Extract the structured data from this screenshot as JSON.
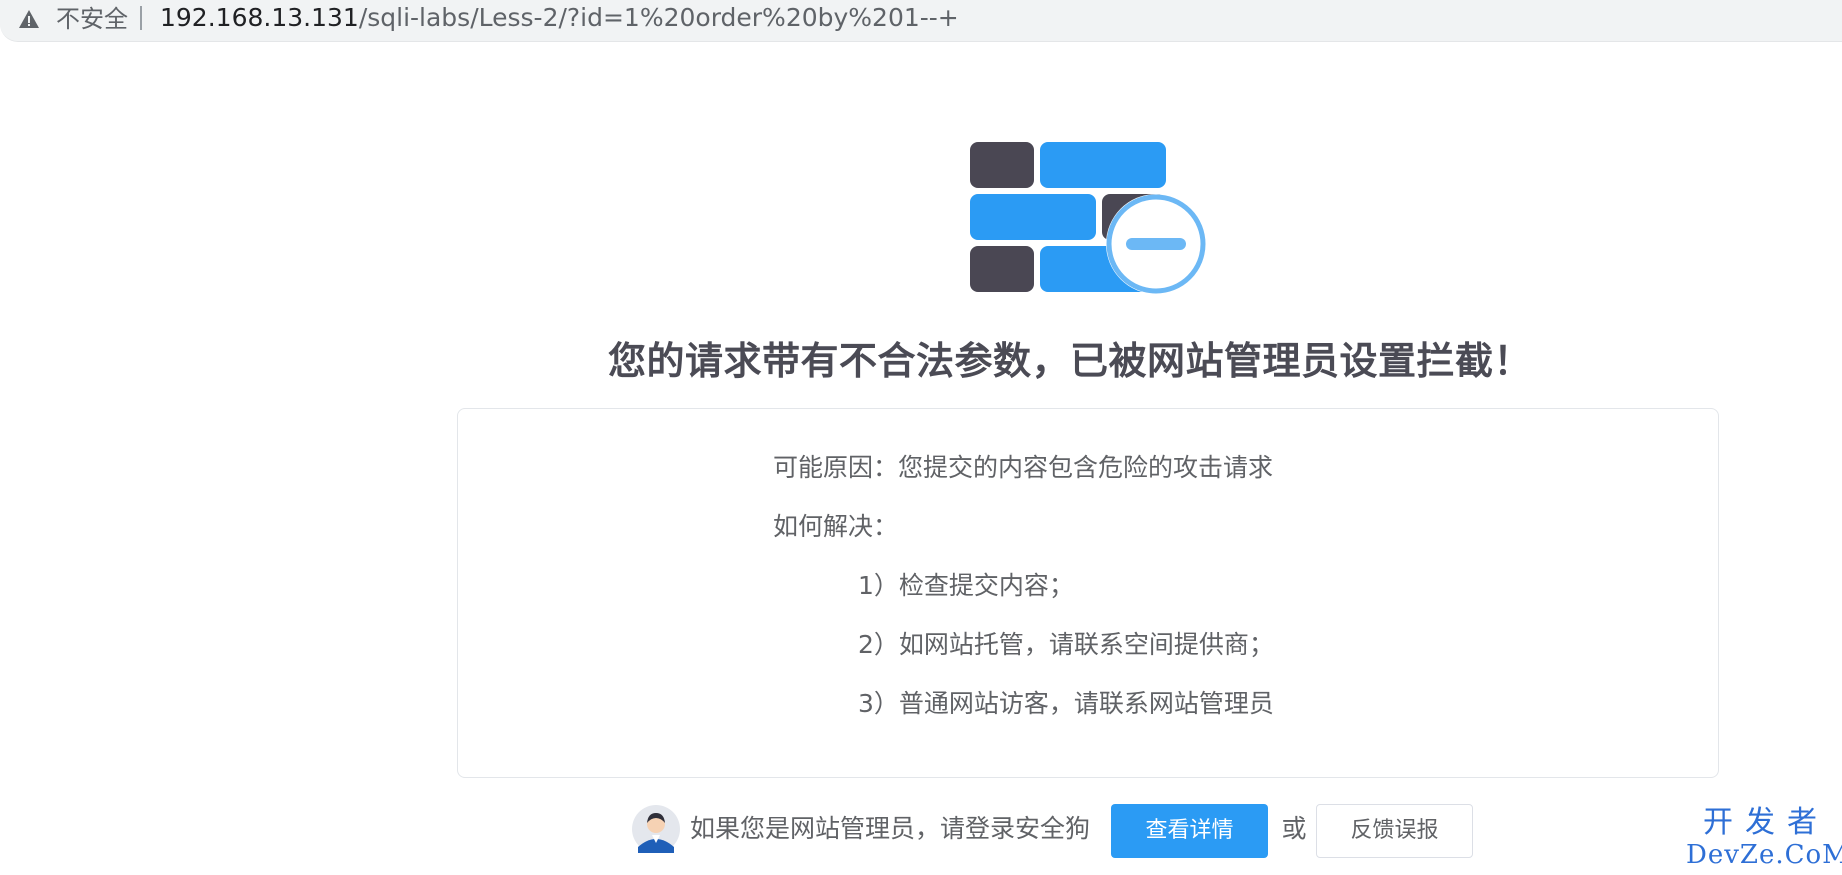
{
  "browser": {
    "security_label": "不安全",
    "url_host": "192.168.13.131",
    "url_path": "/sqli-labs/Less-2/?id=1%20order%20by%201--+"
  },
  "page": {
    "title": "您的请求带有不合法参数，已被网站管理员设置拦截！",
    "reason": "可能原因：您提交的内容包含危险的攻击请求",
    "solution_heading": "如何解决：",
    "steps": [
      "1）检查提交内容；",
      "2）如网站托管，请联系空间提供商；",
      "3）普通网站访客，请联系网站管理员"
    ]
  },
  "footer": {
    "admin_prompt": "如果您是网站管理员，请登录安全狗",
    "details_button": "查看详情",
    "or_text": "或",
    "feedback_button": "反馈误报"
  },
  "watermark": {
    "cn": "开发者",
    "en": "DevZe.CoM"
  },
  "icons": {
    "warning": "warning-triangle-icon",
    "hero": "firewall-blocked-icon",
    "avatar": "admin-avatar-icon"
  },
  "colors": {
    "accent_blue": "#2b9bf4",
    "dark_brick": "#4a4753",
    "badge_blue": "#6cb8f5",
    "title_text": "#4b4b55",
    "body_text": "#606266",
    "watermark": "#2e6fd6"
  }
}
